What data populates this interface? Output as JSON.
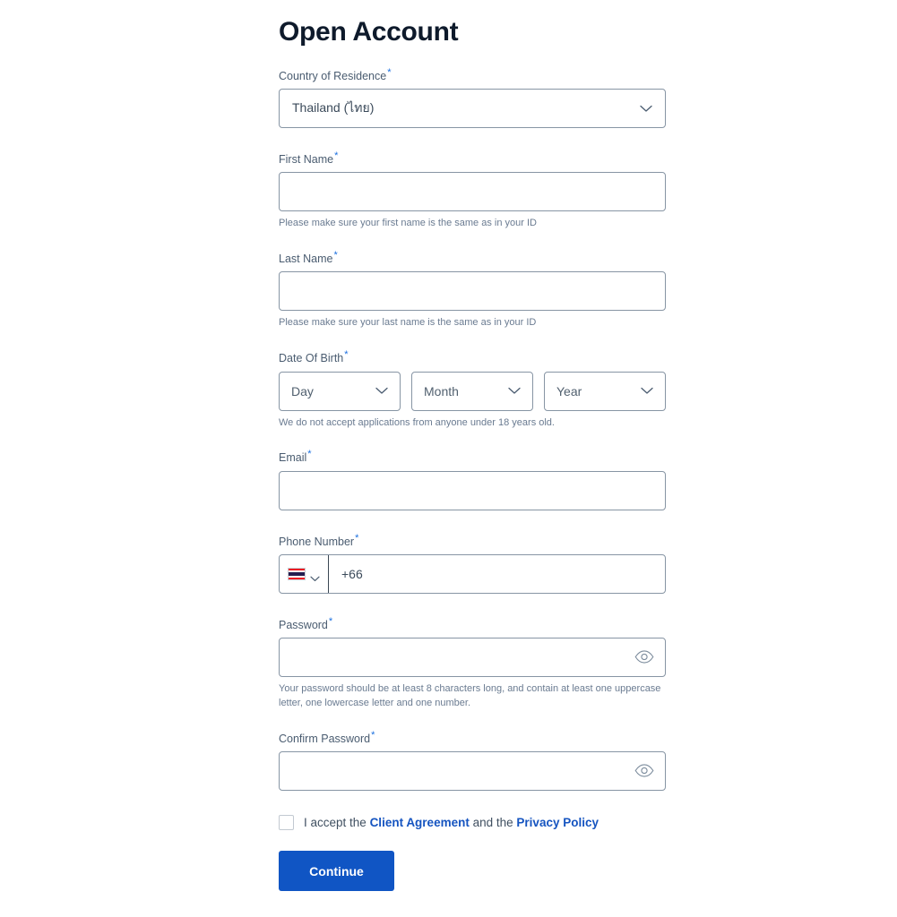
{
  "page": {
    "title": "Open Account"
  },
  "colors": {
    "title": "#0e1a2b",
    "accent": "#1055c4",
    "link": "#1554c0",
    "required_star": "#1a6fe0",
    "border": "#8795a4",
    "helper_text": "#6a7b91",
    "label_text": "#4a5c70"
  },
  "fields": {
    "country": {
      "label": "Country of Residence",
      "required_marker": "*",
      "value": "Thailand (ไทย)",
      "icon": "chevron-down-icon"
    },
    "first_name": {
      "label": "First Name",
      "required_marker": "*",
      "value": "",
      "placeholder": "",
      "helper": "Please make sure your first name is the same as in your ID"
    },
    "last_name": {
      "label": "Last Name",
      "required_marker": "*",
      "value": "",
      "placeholder": "",
      "helper": "Please make sure your last name is the same as in your ID"
    },
    "date_of_birth": {
      "label": "Date Of Birth",
      "required_marker": "*",
      "helper": "We do not accept applications from anyone under 18 years old.",
      "day": {
        "placeholder": "Day",
        "value": "",
        "icon": "chevron-down-icon"
      },
      "month": {
        "placeholder": "Month",
        "value": "",
        "icon": "chevron-down-icon"
      },
      "year": {
        "placeholder": "Year",
        "value": "",
        "icon": "chevron-down-icon"
      }
    },
    "email": {
      "label": "Email",
      "required_marker": "*",
      "value": "",
      "placeholder": ""
    },
    "phone": {
      "label": "Phone Number",
      "required_marker": "*",
      "country_flag": "thailand-flag-icon",
      "country_chevron": "chevron-down-icon",
      "value": "+66",
      "placeholder": "+66"
    },
    "password": {
      "label": "Password",
      "required_marker": "*",
      "value": "",
      "placeholder": "",
      "toggle_icon": "eye-icon",
      "helper": "Your password should be at least 8 characters long, and contain at least one uppercase letter, one lowercase letter and one number."
    },
    "confirm_password": {
      "label": "Confirm Password",
      "required_marker": "*",
      "value": "",
      "placeholder": "",
      "toggle_icon": "eye-icon"
    }
  },
  "consent": {
    "checked": false,
    "text_before": "I accept the",
    "link_one": "Client Agreement",
    "text_middle": "and the",
    "link_two": "Privacy Policy"
  },
  "actions": {
    "continue_label": "Continue"
  }
}
